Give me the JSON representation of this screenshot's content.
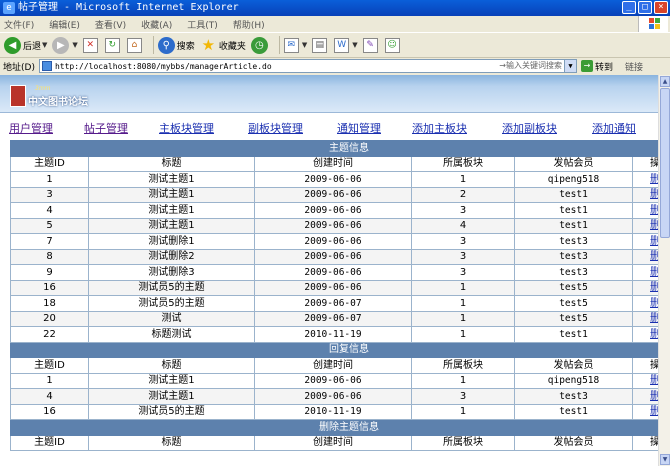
{
  "window": {
    "title": "帖子管理 - Microsoft Internet Explorer"
  },
  "menubar": [
    "文件(F)",
    "编辑(E)",
    "查看(V)",
    "收藏(A)",
    "工具(T)",
    "帮助(H)"
  ],
  "toolbar": {
    "back": "后退",
    "search": "搜索",
    "favorites": "收藏夹"
  },
  "address": {
    "label": "地址(D)",
    "url": "http://localhost:8080/mybbs/managerArticle.do",
    "search_hint": "→输入关键词搜索",
    "go": "转到",
    "links": "链接"
  },
  "site": {
    "logo_sup": "3mm",
    "logo_name": "中文图书论坛"
  },
  "nav": [
    "用户管理",
    "帖子管理",
    "主板块管理",
    "副板块管理",
    "通知管理",
    "添加主板块",
    "添加副板块",
    "添加通知"
  ],
  "columns": [
    "主题ID",
    "标题",
    "创建时间",
    "所属板块",
    "发帖会员",
    "操作"
  ],
  "sections": {
    "topics_title": "主题信息",
    "replies_title": "回复信息",
    "deleted_title": "删除主题信息"
  },
  "topics": [
    {
      "id": "1",
      "title": "测试主题1",
      "created": "2009-06-06",
      "board": "1",
      "member": "qipeng518",
      "action": "删除"
    },
    {
      "id": "3",
      "title": "测试主题1",
      "created": "2009-06-06",
      "board": "2",
      "member": "test1",
      "action": "删除"
    },
    {
      "id": "4",
      "title": "测试主题1",
      "created": "2009-06-06",
      "board": "3",
      "member": "test1",
      "action": "删除"
    },
    {
      "id": "5",
      "title": "测试主题1",
      "created": "2009-06-06",
      "board": "4",
      "member": "test1",
      "action": "删除"
    },
    {
      "id": "7",
      "title": "测试删除1",
      "created": "2009-06-06",
      "board": "3",
      "member": "test3",
      "action": "删除"
    },
    {
      "id": "8",
      "title": "测试删除2",
      "created": "2009-06-06",
      "board": "3",
      "member": "test3",
      "action": "删除"
    },
    {
      "id": "9",
      "title": "测试删除3",
      "created": "2009-06-06",
      "board": "3",
      "member": "test3",
      "action": "删除"
    },
    {
      "id": "16",
      "title": "测试员5的主题",
      "created": "2009-06-06",
      "board": "1",
      "member": "test5",
      "action": "删除"
    },
    {
      "id": "18",
      "title": "测试员5的主题",
      "created": "2009-06-07",
      "board": "1",
      "member": "test5",
      "action": "删除"
    },
    {
      "id": "20",
      "title": "测试",
      "created": "2009-06-07",
      "board": "1",
      "member": "test5",
      "action": "删除"
    },
    {
      "id": "22",
      "title": "标题测试",
      "created": "2010-11-19",
      "board": "1",
      "member": "test1",
      "action": "删除"
    }
  ],
  "replies": [
    {
      "id": "1",
      "title": "测试主题1",
      "created": "2009-06-06",
      "board": "1",
      "member": "qipeng518",
      "action": "删除"
    },
    {
      "id": "4",
      "title": "测试主题1",
      "created": "2009-06-06",
      "board": "3",
      "member": "test3",
      "action": "删除"
    },
    {
      "id": "16",
      "title": "测试员5的主题",
      "created": "2010-11-19",
      "board": "1",
      "member": "test1",
      "action": "删除"
    }
  ]
}
